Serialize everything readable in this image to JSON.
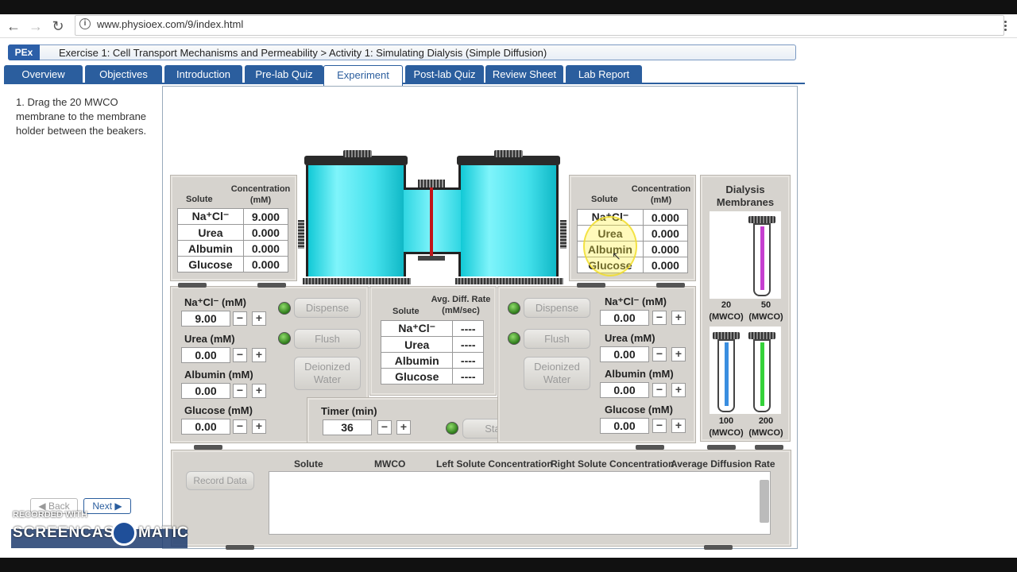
{
  "browser": {
    "url": "www.physioex.com/9/index.html",
    "info_icon": "i"
  },
  "header": {
    "logo": "PEx",
    "breadcrumb": "Exercise 1: Cell Transport Mechanisms and Permeability > Activity 1: Simulating Dialysis (Simple Diffusion)"
  },
  "tabs": [
    "Overview",
    "Objectives",
    "Introduction",
    "Pre-lab Quiz",
    "Experiment",
    "Post-lab Quiz",
    "Review Sheet",
    "Lab Report"
  ],
  "active_tab": "Experiment",
  "instructions": "1. Drag the 20 MWCO membrane to the membrane holder between the beakers.",
  "left_table": {
    "col_solute": "Solute",
    "col_conc": "Concentration (mM)",
    "rows": [
      {
        "solute": "Na⁺Cl⁻",
        "value": "9.000"
      },
      {
        "solute": "Urea",
        "value": "0.000"
      },
      {
        "solute": "Albumin",
        "value": "0.000"
      },
      {
        "solute": "Glucose",
        "value": "0.000"
      }
    ]
  },
  "right_table": {
    "col_solute": "Solute",
    "col_conc": "Concentration (mM)",
    "rows": [
      {
        "solute": "Na⁺Cl⁻",
        "value": "0.000"
      },
      {
        "solute": "Urea",
        "value": "0.000"
      },
      {
        "solute": "Albumin",
        "value": "0.000"
      },
      {
        "solute": "Glucose",
        "value": "0.000"
      }
    ]
  },
  "left_controls": {
    "nacl_label": "Na⁺Cl⁻ (mM)",
    "nacl_value": "9.00",
    "urea_label": "Urea (mM)",
    "urea_value": "0.00",
    "albumin_label": "Albumin (mM)",
    "albumin_value": "0.00",
    "glucose_label": "Glucose (mM)",
    "glucose_value": "0.00",
    "dispense": "Dispense",
    "flush": "Flush",
    "deionized": "Deionized Water"
  },
  "right_controls": {
    "nacl_label": "Na⁺Cl⁻ (mM)",
    "nacl_value": "0.00",
    "urea_label": "Urea (mM)",
    "urea_value": "0.00",
    "albumin_label": "Albumin (mM)",
    "albumin_value": "0.00",
    "glucose_label": "Glucose (mM)",
    "glucose_value": "0.00",
    "dispense": "Dispense",
    "flush": "Flush",
    "deionized": "Deionized Water"
  },
  "rate_table": {
    "col_solute": "Solute",
    "col_rate": "Avg. Diff. Rate (mM/sec)",
    "rows": [
      {
        "solute": "Na⁺Cl⁻",
        "value": "----"
      },
      {
        "solute": "Urea",
        "value": "----"
      },
      {
        "solute": "Albumin",
        "value": "----"
      },
      {
        "solute": "Glucose",
        "value": "----"
      }
    ]
  },
  "timer": {
    "label": "Timer (min)",
    "value": "36",
    "start": "Start"
  },
  "membranes": {
    "title": "Dialysis Membranes",
    "items": [
      {
        "size": "20",
        "unit": "(MWCO)",
        "color": ""
      },
      {
        "size": "50",
        "unit": "(MWCO)",
        "color": "#c63fd0"
      },
      {
        "size": "100",
        "unit": "(MWCO)",
        "color": "#3a8ee0"
      },
      {
        "size": "200",
        "unit": "(MWCO)",
        "color": "#35d23a"
      }
    ]
  },
  "results": {
    "record_button": "Record Data",
    "columns": [
      "Solute",
      "MWCO",
      "Left Solute Concentration",
      "Right Solute Concentration",
      "Average Diffusion Rate"
    ]
  },
  "nav": {
    "back": "Back",
    "next": "Next"
  },
  "watermark": {
    "line1": "RECORDED WITH",
    "line2": "SCREENCAST",
    "line3": "MATIC"
  },
  "colors": {
    "beaker_fluid": "#3fe0ec",
    "tab_blue": "#2b5e9e",
    "membrane_line": "#c0161a"
  }
}
